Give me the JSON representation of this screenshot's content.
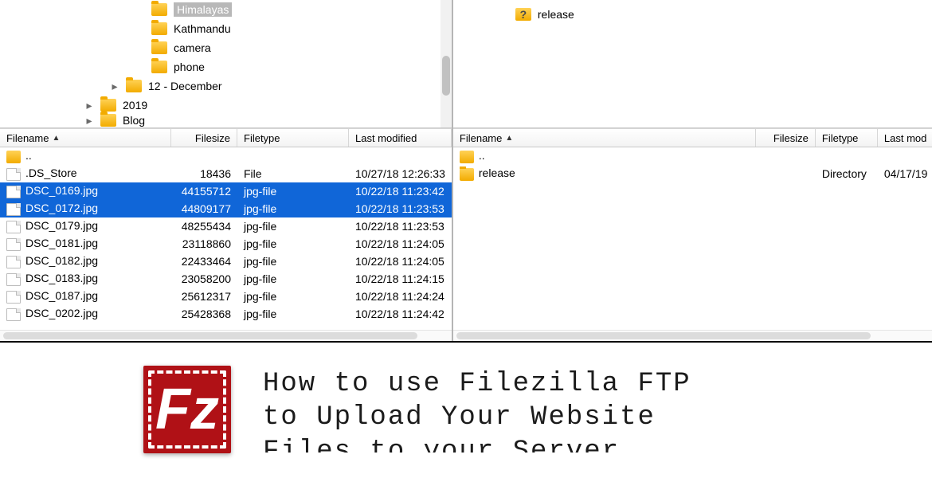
{
  "local_tree": {
    "items": [
      {
        "indent": 170,
        "label": "Himalayas",
        "selected": true,
        "expander": ""
      },
      {
        "indent": 170,
        "label": "Kathmandu",
        "expander": ""
      },
      {
        "indent": 170,
        "label": "camera",
        "expander": ""
      },
      {
        "indent": 170,
        "label": "phone",
        "expander": ""
      },
      {
        "indent": 138,
        "label": "12 - December",
        "expander": "▸"
      },
      {
        "indent": 106,
        "label": "2019",
        "expander": "▸"
      },
      {
        "indent": 106,
        "label": "Blog",
        "expander": "▸",
        "cut": true
      }
    ]
  },
  "remote_tree": {
    "items": [
      {
        "indent": 58,
        "label": "release",
        "icon": "question"
      }
    ]
  },
  "columns_local": {
    "filename": "Filename",
    "filesize": "Filesize",
    "filetype": "Filetype",
    "lastmod": "Last modified",
    "widths": {
      "filename": 215,
      "filesize": 83,
      "filetype": 140,
      "lastmod": 142
    }
  },
  "columns_remote": {
    "filename": "Filename",
    "filesize": "Filesize",
    "filetype": "Filetype",
    "lastmod": "Last mod",
    "widths": {
      "filename": 380,
      "filesize": 75,
      "filetype": 78,
      "lastmod": 57
    }
  },
  "local_files": [
    {
      "name": "..",
      "icon": "up",
      "filesize": "",
      "filetype": "",
      "lastmod": ""
    },
    {
      "name": ".DS_Store",
      "icon": "file",
      "filesize": "18436",
      "filetype": "File",
      "lastmod": "10/27/18 12:26:33"
    },
    {
      "name": "DSC_0169.jpg",
      "icon": "file",
      "filesize": "44155712",
      "filetype": "jpg-file",
      "lastmod": "10/22/18 11:23:42",
      "selected": true
    },
    {
      "name": "DSC_0172.jpg",
      "icon": "file",
      "filesize": "44809177",
      "filetype": "jpg-file",
      "lastmod": "10/22/18 11:23:53",
      "selected": true
    },
    {
      "name": "DSC_0179.jpg",
      "icon": "file",
      "filesize": "48255434",
      "filetype": "jpg-file",
      "lastmod": "10/22/18 11:23:53"
    },
    {
      "name": "DSC_0181.jpg",
      "icon": "file",
      "filesize": "23118860",
      "filetype": "jpg-file",
      "lastmod": "10/22/18 11:24:05"
    },
    {
      "name": "DSC_0182.jpg",
      "icon": "file",
      "filesize": "22433464",
      "filetype": "jpg-file",
      "lastmod": "10/22/18 11:24:05"
    },
    {
      "name": "DSC_0183.jpg",
      "icon": "file",
      "filesize": "23058200",
      "filetype": "jpg-file",
      "lastmod": "10/22/18 11:24:15"
    },
    {
      "name": "DSC_0187.jpg",
      "icon": "file",
      "filesize": "25612317",
      "filetype": "jpg-file",
      "lastmod": "10/22/18 11:24:24"
    },
    {
      "name": "DSC_0202.jpg",
      "icon": "file",
      "filesize": "25428368",
      "filetype": "jpg-file",
      "lastmod": "10/22/18 11:24:42"
    }
  ],
  "remote_files": [
    {
      "name": "..",
      "icon": "up",
      "filesize": "",
      "filetype": "",
      "lastmod": ""
    },
    {
      "name": "release",
      "icon": "folder",
      "filesize": "",
      "filetype": "Directory",
      "lastmod": "04/17/19"
    }
  ],
  "footer": {
    "logo_text": "Fz",
    "line1": "How to use Filezilla FTP",
    "line2": "to Upload Your Website",
    "line3": "Files to your Server"
  }
}
